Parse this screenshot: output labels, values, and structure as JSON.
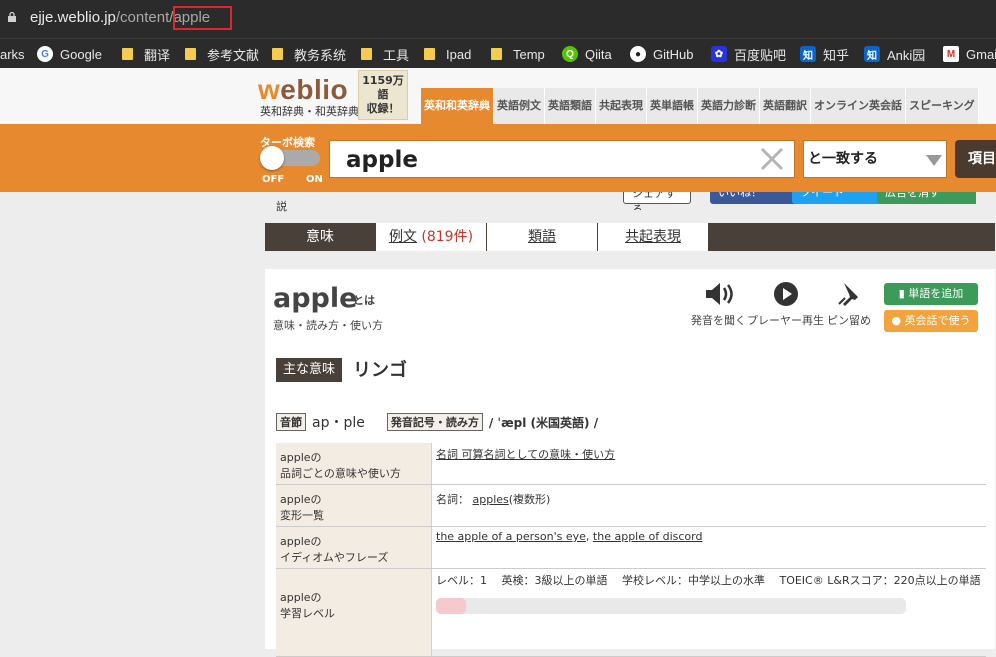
{
  "browser": {
    "url_domain": "ejje.weblio.jp",
    "url_path": "/content/",
    "url_highlight": "apple",
    "bookmarks": [
      {
        "label": "arks",
        "icon": "none"
      },
      {
        "label": "Google",
        "icon": "google-icon"
      },
      {
        "label": "翻译",
        "icon": "folder-icon"
      },
      {
        "label": "参考文献",
        "icon": "folder-icon"
      },
      {
        "label": "教务系统",
        "icon": "folder-icon"
      },
      {
        "label": "工具",
        "icon": "folder-icon"
      },
      {
        "label": "Ipad",
        "icon": "folder-icon"
      },
      {
        "label": "Temp",
        "icon": "folder-icon"
      },
      {
        "label": "Qiita",
        "icon": "qiita-icon"
      },
      {
        "label": "GitHub",
        "icon": "github-icon"
      },
      {
        "label": "百度贴吧",
        "icon": "baidu-icon"
      },
      {
        "label": "知乎",
        "icon": "zhihu-icon"
      },
      {
        "label": "Anki园",
        "icon": "zhihu-icon"
      },
      {
        "label": "Gmai",
        "icon": "gmail-icon"
      }
    ]
  },
  "site": {
    "logo_w": "w",
    "logo_rest": "eblio",
    "logo_sub": "英和辞典・和英辞典",
    "count_line1": "1159万",
    "count_line2": "語",
    "count_line3": "収録！",
    "nav": [
      "英和和英辞典",
      "英語例文",
      "英語類語",
      "共起表現",
      "英単語帳",
      "英語力診断",
      "英語翻訳",
      "オンライン英会話",
      "スピーキング"
    ]
  },
  "search": {
    "turbo_label": "ターボ検索",
    "toggle_off": "OFF",
    "toggle_on": "ON",
    "query": "apple",
    "match_mode": "と一致する",
    "item_button": "項目"
  },
  "partial_row": {
    "suffix_text": "説",
    "share_label": "シェアする",
    "like_label": "いいね！",
    "tweet_label": "ツイート",
    "hide_ads_label": "広告を消す"
  },
  "word_tabs": [
    {
      "label": "意味",
      "extra": ""
    },
    {
      "label": "例文",
      "extra": "(819件)"
    },
    {
      "label": "類語",
      "extra": ""
    },
    {
      "label": "共起表現",
      "extra": ""
    }
  ],
  "entry": {
    "headword": "apple",
    "towa": "とは",
    "subtitle": "意味・読み方・使い方",
    "tools": {
      "pronounce": "発音を聞く",
      "player": "プレーヤー再生",
      "pin": "ピン留め"
    },
    "add_word": "単語を追加",
    "eikaiwa": "英会話で使う",
    "main_meaning_label": "主な意味",
    "main_meaning": "リンゴ",
    "syllable_tag": "音節",
    "syllable": "ap・ple",
    "pron_tag": "発音記号・読み方",
    "pron": "/ ˈæpl (米国英語) /",
    "rows": [
      {
        "key1": "appleの",
        "key2": "品詞ごとの意味や使い方",
        "links": [
          "名詞 可算名詞としての意味・使い方"
        ],
        "text": ""
      },
      {
        "key1": "appleの",
        "key2": "変形一覧",
        "links": [],
        "text": "名詞：",
        "link_inline": "apples",
        "text_after": "(複数形)"
      },
      {
        "key1": "appleの",
        "key2": "イディオムやフレーズ",
        "links": [
          "the apple of a person's eye",
          "the apple of discord"
        ],
        "text": ""
      },
      {
        "key1": "appleの",
        "key2": "学習レベル",
        "links": [],
        "text": "レベル：1　 英検：3級以上の単語　 学校レベル：中学以上の水準　 TOEIC® L&Rスコア：220点以上の単語"
      }
    ]
  }
}
